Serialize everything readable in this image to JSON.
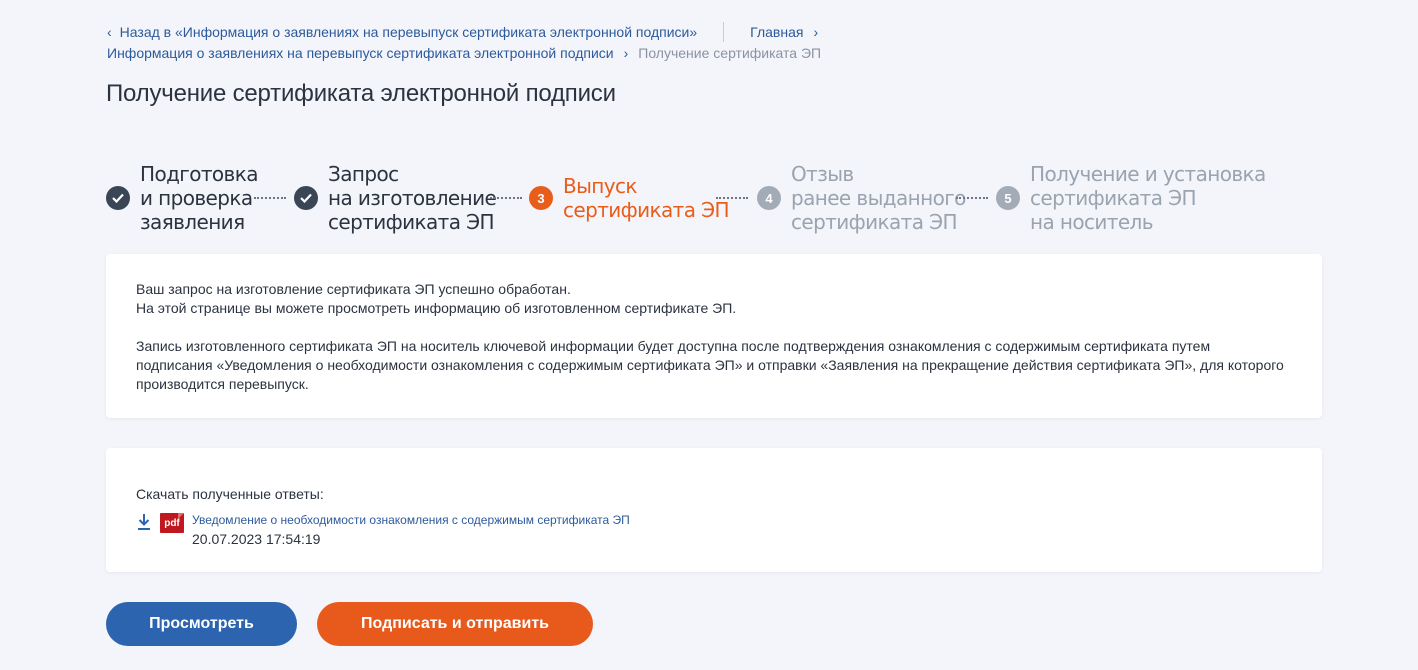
{
  "breadcrumbs": {
    "back_label": "Назад в «Информация о заявлениях на перевыпуск сертификата электронной подписи»",
    "home_label": "Главная",
    "parent_label": "Информация о заявлениях на перевыпуск сертификата электронной подписи",
    "current_label": "Получение сертификата ЭП"
  },
  "page_title": "Получение сертификата электронной подписи",
  "steps": [
    {
      "number": "1",
      "label": "Подготовка\nи проверка\nзаявления",
      "state": "done"
    },
    {
      "number": "2",
      "label": "Запрос\nна изготовление\nсертификата ЭП",
      "state": "done"
    },
    {
      "number": "3",
      "label": "Выпуск\nсертификата ЭП",
      "state": "active"
    },
    {
      "number": "4",
      "label": "Отзыв\nранее выданного\nсертификата ЭП",
      "state": "todo"
    },
    {
      "number": "5",
      "label": "Получение и установка\nсертификата ЭП\nна носитель",
      "state": "todo"
    }
  ],
  "info": {
    "line1": "Ваш запрос на изготовление сертификата ЭП успешно обработан.",
    "line2": "На этой странице вы можете просмотреть информацию об изготовленном сертификате ЭП.",
    "paragraph": "Запись изготовленного сертификата ЭП на носитель ключевой информации будет доступна после подтверждения ознакомления с содержимым сертификата путем подписания «Уведомления о необходимости ознакомления с содержимым сертификата ЭП» и отправки «Заявления на прекращение действия сертификата ЭП», для которого производится перевыпуск."
  },
  "downloads": {
    "title": "Скачать полученные ответы:",
    "file_type": "pdf",
    "file_name": "Уведомление о необходимости ознакомления с содержимым сертификата ЭП",
    "file_date": "20.07.2023 17:54:19"
  },
  "buttons": {
    "view_label": "Просмотреть",
    "sign_label": "Подписать и отправить"
  },
  "colors": {
    "accent_blue": "#2c64b0",
    "accent_orange": "#e8591c",
    "done_step": "#3a4656",
    "todo_step": "#a3abb7"
  }
}
